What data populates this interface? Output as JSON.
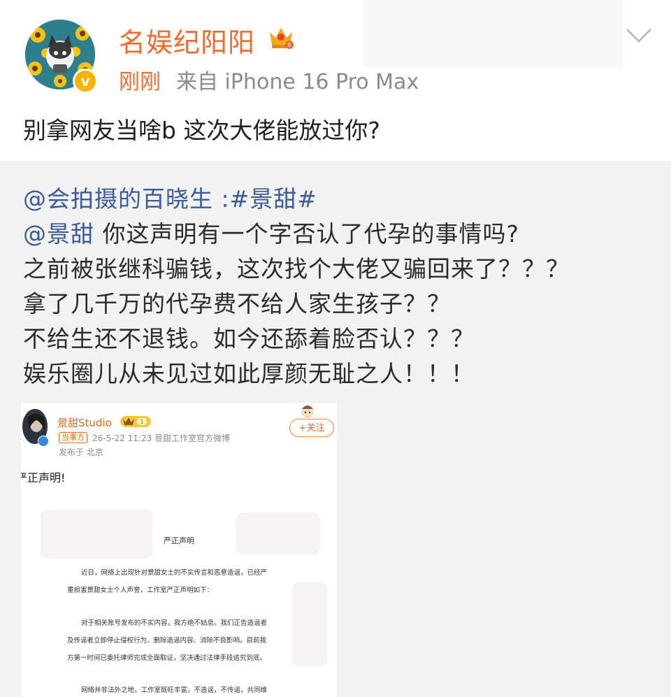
{
  "post": {
    "username": "名娱纪阳阳",
    "time": "刚刚",
    "source": "来自 iPhone 16 Pro Max",
    "text": "别拿网友当啥b 这次大佬能放过你?"
  },
  "repost": {
    "lines": [
      {
        "mention": "@会拍摄的百晓生",
        "rest": " :#景甜#"
      },
      {
        "mention": "@景甜",
        "rest": " 你这声明有一个字否认了代孕的事情吗?"
      },
      {
        "mention": "",
        "rest": "之前被张继科骗钱，这次找个大佬又骗回来了？？？"
      },
      {
        "mention": "",
        "rest": "拿了几千万的代孕费不给人家生孩子？？"
      },
      {
        "mention": "",
        "rest": "不给生还不退钱。如今还舔着脸否认？？？"
      },
      {
        "mention": "",
        "rest": "娱乐圈儿从未见过如此厚颜无耻之人！！！"
      }
    ]
  },
  "screenshot": {
    "name": "景甜Studio",
    "tag": "当事方",
    "meta": "26-5-22 11:23  景甜工作室官方微博",
    "location": "发布于 北京",
    "follow": "+关注",
    "title": "严正声明！",
    "title_prefix": "严",
    "doc": {
      "heading": "严正声明",
      "lines": [
        "近日，网络上出现针对景甜女士的不实传言和恶意造谣，已经严",
        "重损害景甜女士个人声誉，工作室严正声明如下：",
        "对于相关账号发布的不实内容，我方绝不姑息。我们正告造谣者",
        "及传谣者立即停止侵权行为、删除造谣内容、消除不良影响。目前我",
        "方第一时间已委托律师完成全面取证，坚决通过法律手段追究到底。",
        "网络并非法外之地，工作室既旺丰富，不造谣，不传谣，共同维"
      ]
    }
  },
  "colors": {
    "accent_orange": "#f26b2a",
    "link_blue": "#3b5a9a",
    "verified_gold": "#f6b400"
  },
  "icons": [
    "crown-icon",
    "verified-icon",
    "chevron-down-icon",
    "follow-plus-icon"
  ]
}
